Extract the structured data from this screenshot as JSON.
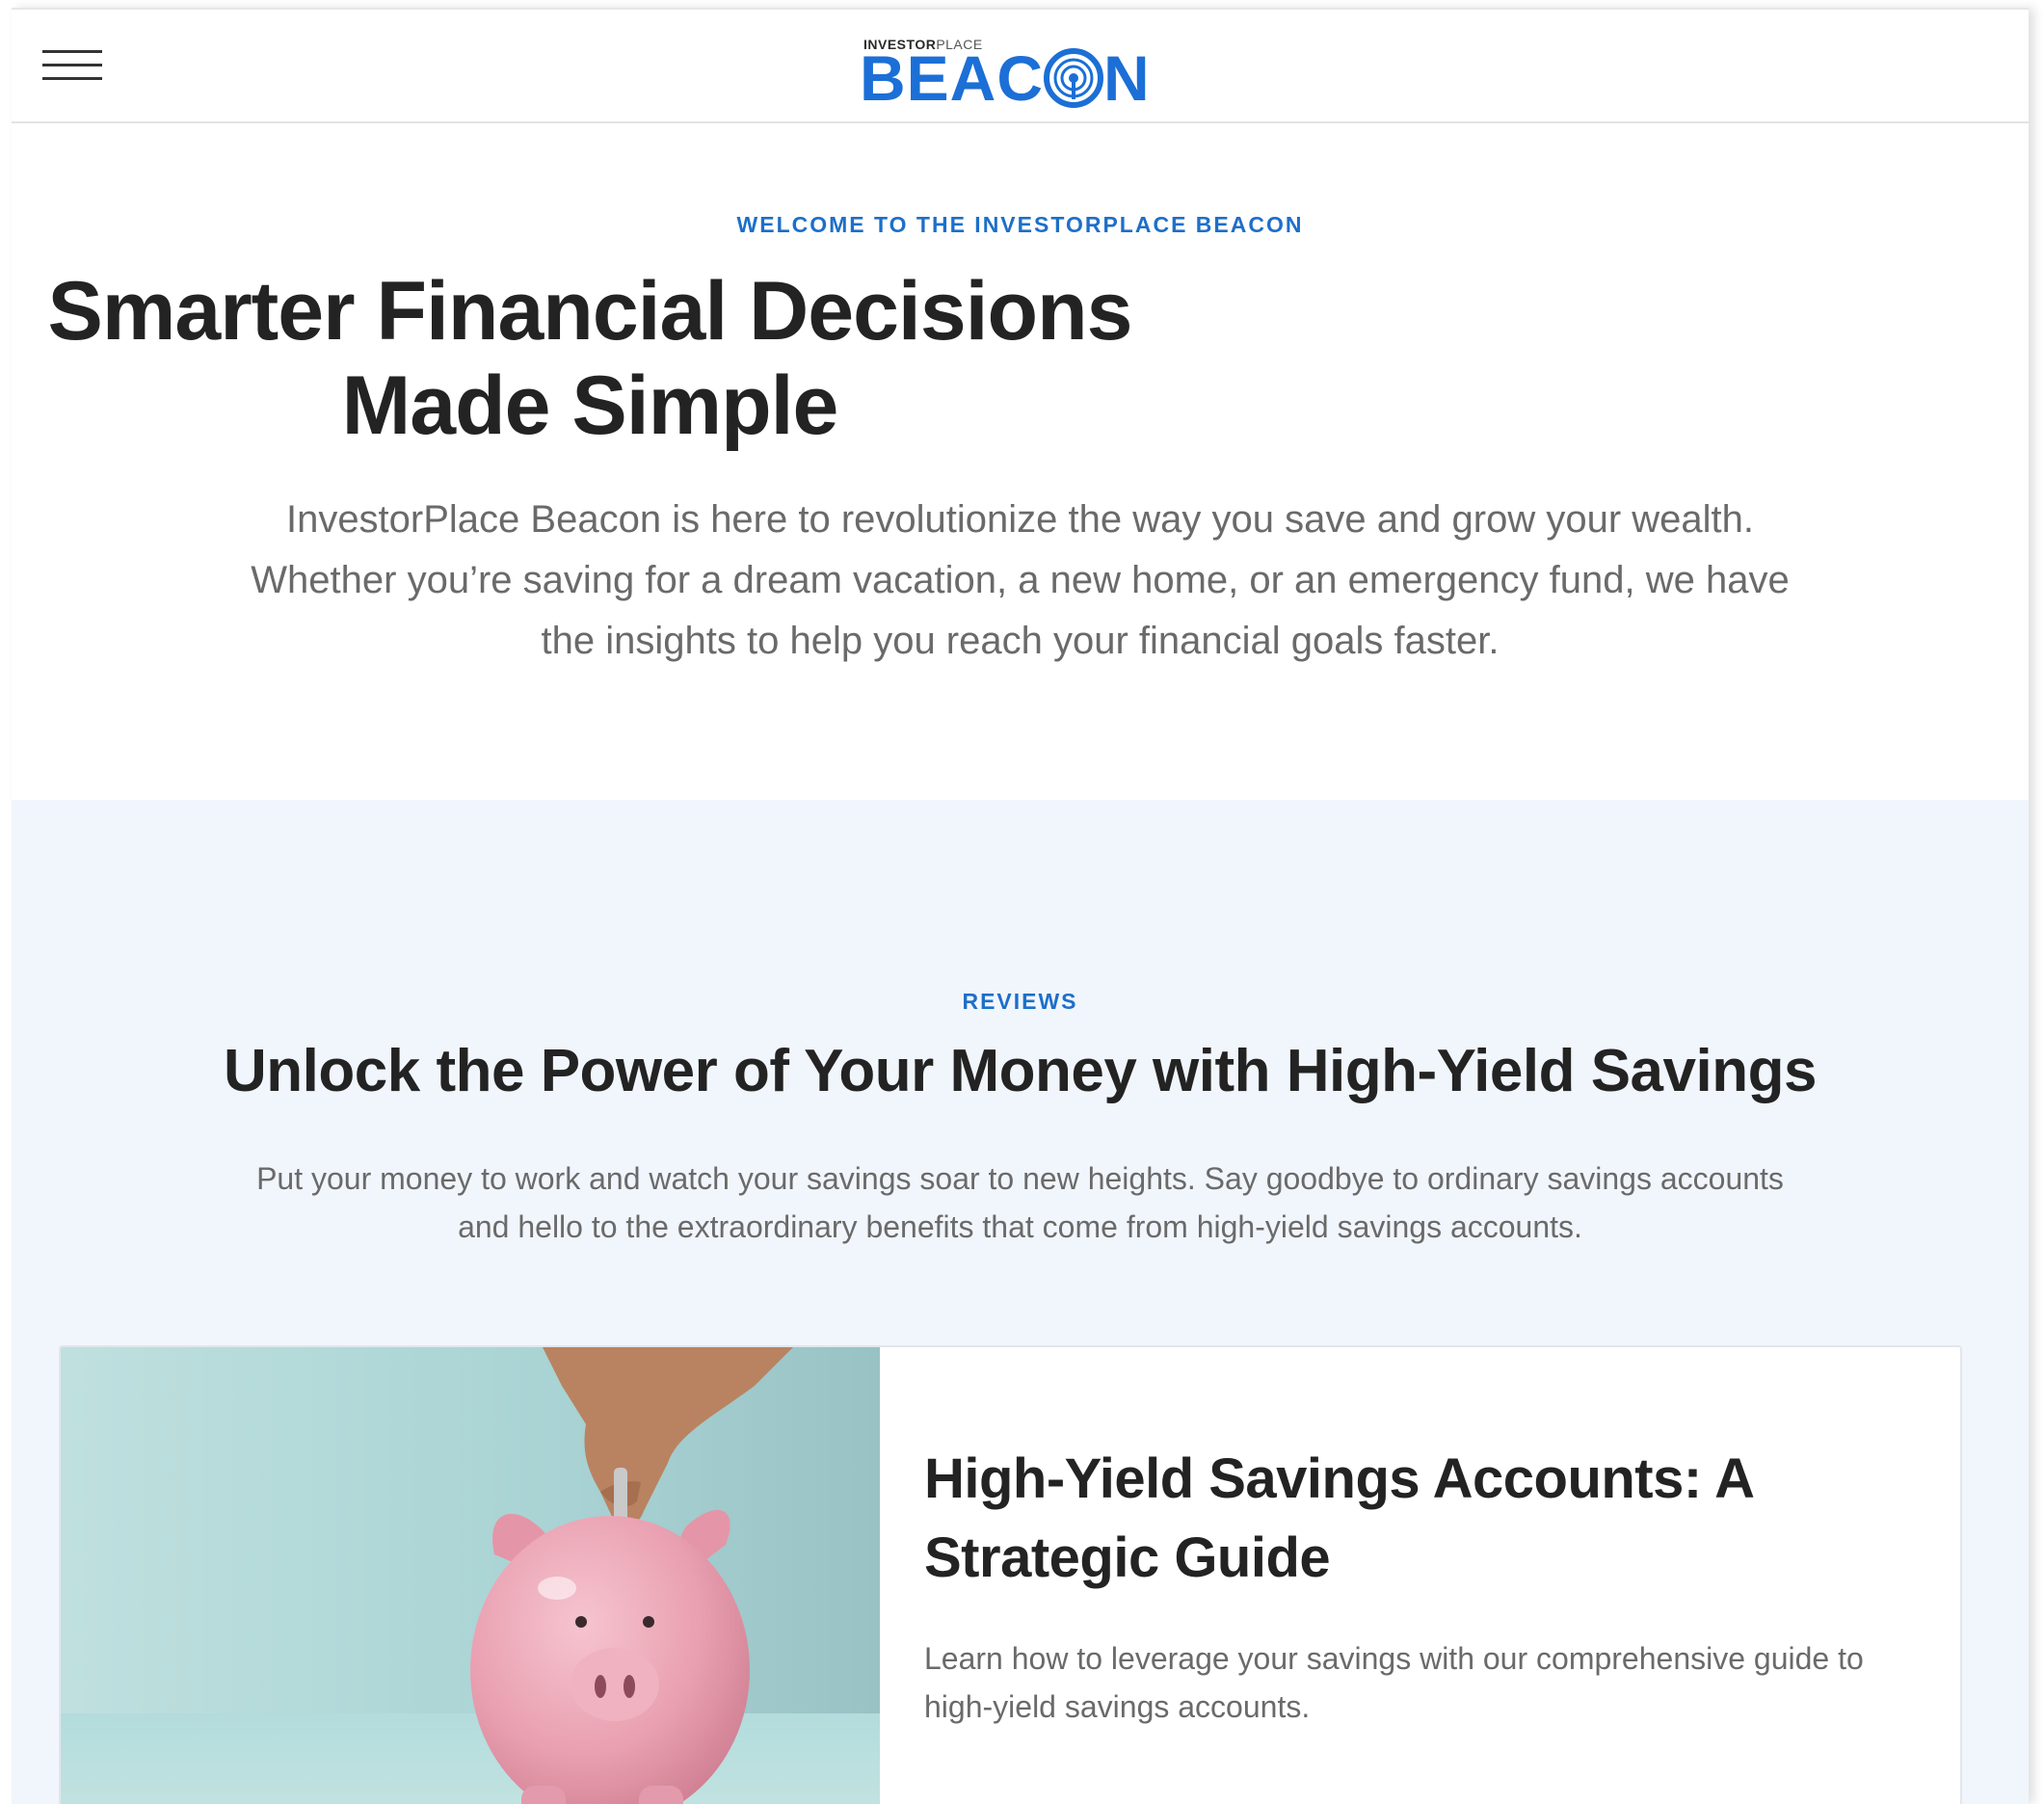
{
  "header": {
    "menu_icon": "hamburger-menu-icon",
    "logo": {
      "top_bold": "INVESTOR",
      "top_light": "PLACE",
      "main_left": "BEAC",
      "main_right": "N",
      "icon": "broadcast-target-icon",
      "color": "#1b6fd6"
    }
  },
  "hero": {
    "eyebrow": "WELCOME TO THE INVESTORPLACE BEACON",
    "title_line1": "Smarter Financial Decisions",
    "title_line2": "Made Simple",
    "description": "InvestorPlace Beacon is here to revolutionize the way you save and grow your wealth. Whether you’re saving for a dream vacation, a new home, or an emergency fund, we have the insights to help you reach your financial goals faster."
  },
  "reviews": {
    "eyebrow": "REVIEWS",
    "title": "Unlock the Power of Your Money with High-Yield Savings",
    "description": "Put your money to work and watch your savings soar to new heights. Say goodbye to ordinary savings accounts and hello to the extraordinary benefits that come from high-yield savings accounts.",
    "cards": [
      {
        "image": "piggy-bank-coin-photo",
        "title": "High-Yield Savings Accounts: A Strategic Guide",
        "description": "Learn how to leverage your savings with our comprehensive guide to high-yield savings accounts."
      }
    ]
  },
  "colors": {
    "accent": "#1d6fc9",
    "section_bg": "#f1f6fd",
    "heading": "#232323",
    "body_text": "#6a6a6a"
  }
}
